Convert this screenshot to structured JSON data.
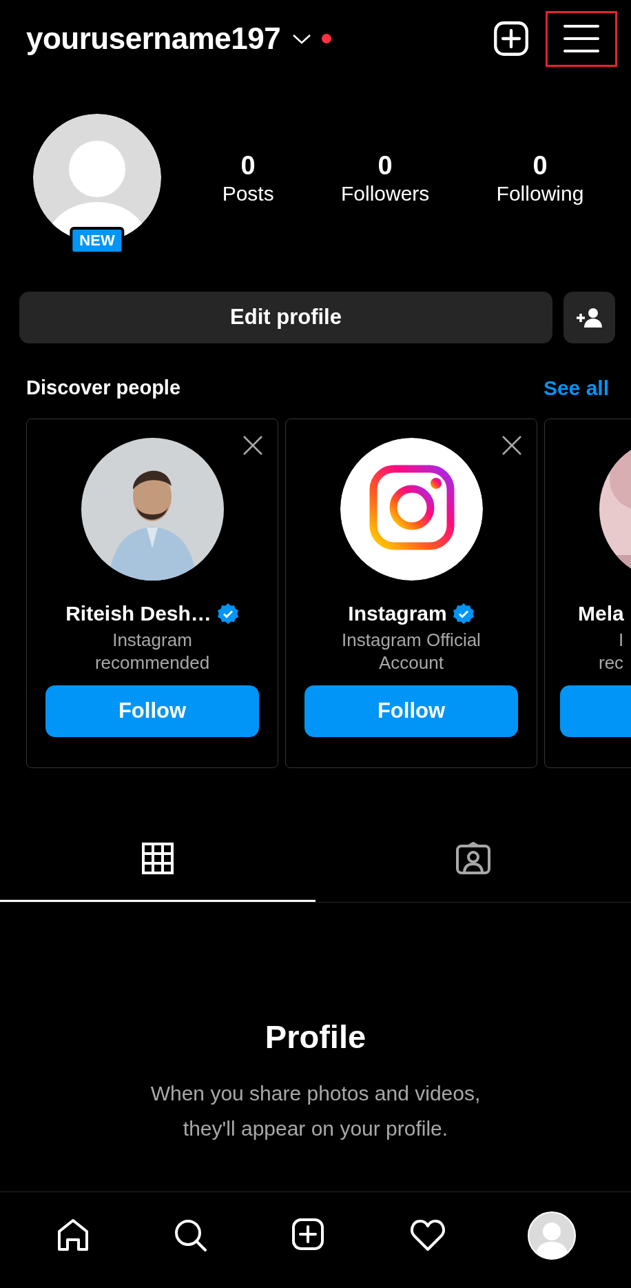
{
  "header": {
    "username": "yourusername197",
    "has_notification": true,
    "menu_highlighted": true
  },
  "profile": {
    "badge": "NEW",
    "stats": [
      {
        "value": "0",
        "label": "Posts"
      },
      {
        "value": "0",
        "label": "Followers"
      },
      {
        "value": "0",
        "label": "Following"
      }
    ],
    "edit_button": "Edit profile"
  },
  "discover": {
    "title": "Discover people",
    "see_all": "See all",
    "cards": [
      {
        "kind": "person",
        "name": "Riteish Desh…",
        "verified": true,
        "subtitle_lines": [
          "Instagram",
          "recommended"
        ],
        "button": "Follow",
        "dismissible": true
      },
      {
        "kind": "logo",
        "name": "Instagram",
        "verified": true,
        "subtitle_lines": [
          "Instagram Official",
          "Account"
        ],
        "button": "Follow",
        "dismissible": true
      },
      {
        "kind": "person",
        "name": "Mela",
        "verified": false,
        "subtitle_lines": [
          "I",
          "rec"
        ],
        "dismissible": false
      }
    ]
  },
  "tabs": [
    {
      "kind": "grid",
      "selected": true
    },
    {
      "kind": "tagged",
      "selected": false
    }
  ],
  "empty_state": {
    "title": "Profile",
    "text": "When you share photos and videos, they'll appear on your profile."
  },
  "bottom_nav": [
    {
      "kind": "home"
    },
    {
      "kind": "search"
    },
    {
      "kind": "create"
    },
    {
      "kind": "activity"
    },
    {
      "kind": "profile"
    }
  ]
}
